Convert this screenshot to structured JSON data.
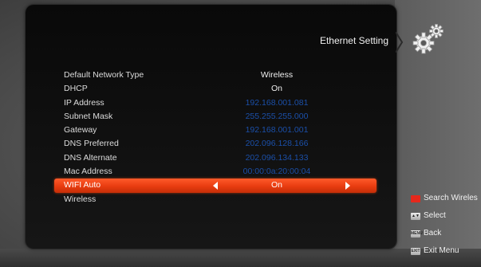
{
  "panel": {
    "title": "Ethernet Setting"
  },
  "settings": [
    {
      "label": "Default Network Type",
      "value": "Wireless"
    },
    {
      "label": "DHCP",
      "value": "On"
    },
    {
      "label": "IP Address",
      "value": "192.168.001.081"
    },
    {
      "label": "Subnet Mask",
      "value": "255.255.255.000"
    },
    {
      "label": "Gateway",
      "value": "192.168.001.001"
    },
    {
      "label": "DNS Preferred",
      "value": "202.096.128.166"
    },
    {
      "label": "DNS Alternate",
      "value": "202.096.134.133"
    },
    {
      "label": "Mac Address",
      "value": "00:00:0a:20:00:04"
    },
    {
      "label": "WIFI Auto",
      "value": "On"
    },
    {
      "label": "Wireless",
      "value": ""
    }
  ],
  "legend": {
    "search": "Search Wireles",
    "select": "Select",
    "back": "Back",
    "exit": "Exit Menu",
    "back_key": "MENU",
    "exit_key": "EXIT"
  },
  "colors": {
    "highlight": "#e83c10",
    "value_blue": "#1b4fa8",
    "legend_red": "#e5281c"
  },
  "icons": [
    "gears-icon",
    "left-arrow-icon",
    "right-arrow-icon",
    "red-key-icon",
    "updown-key-icon",
    "menu-key-icon",
    "exit-key-icon"
  ]
}
